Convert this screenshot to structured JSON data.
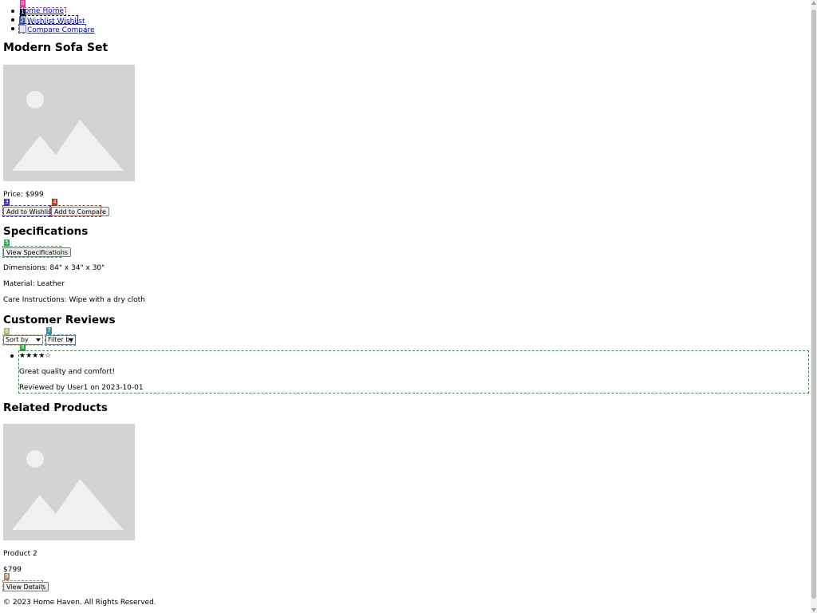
{
  "nav": {
    "items": [
      {
        "label": "Home Home",
        "icon": "home-icon"
      },
      {
        "label": "Wishlist Wishlist",
        "icon": "wishlist-icon"
      },
      {
        "label": "Compare Compare",
        "icon": "compare-icon"
      }
    ]
  },
  "product": {
    "title": "Modern Sofa Set",
    "price": "Price: $999",
    "add_to_wishlist": "Add to Wishlist",
    "add_to_compare": "Add to Compare"
  },
  "specifications": {
    "heading": "Specifications",
    "view_button": "View Specifications",
    "dimensions": "Dimensions: 84\" x 34\" x 30\"",
    "material": "Material: Leather",
    "care": "Care Instructions: Wipe with a dry cloth"
  },
  "reviews": {
    "heading": "Customer Reviews",
    "sort_select": "Sort by",
    "filter_select": "Filter by",
    "items": [
      {
        "stars": "★★★★☆",
        "rating": 4,
        "text": "Great quality and comfort!",
        "byline": "Reviewed by User1 on 2023-10-01"
      }
    ]
  },
  "related": {
    "heading": "Related Products",
    "items": [
      {
        "name": "Product 2",
        "price": "$799",
        "button": "View Details"
      }
    ]
  },
  "footer": {
    "text": "© 2023 Home Haven. All Rights Reserved."
  },
  "overlay": {
    "labels": [
      "0",
      "1",
      "2",
      "3",
      "4",
      "5",
      "6",
      "7",
      "8",
      "9"
    ],
    "colors": [
      "#e0339e",
      "#111133",
      "#3355aa",
      "#4b2ad6",
      "#b83a16",
      "#33aa55",
      "#b0b070",
      "#3a8aa8",
      "#2a9a3a",
      "#a08c60"
    ]
  },
  "colors": {
    "link": "#0000ee",
    "placeholder": "#d3d3d3"
  }
}
